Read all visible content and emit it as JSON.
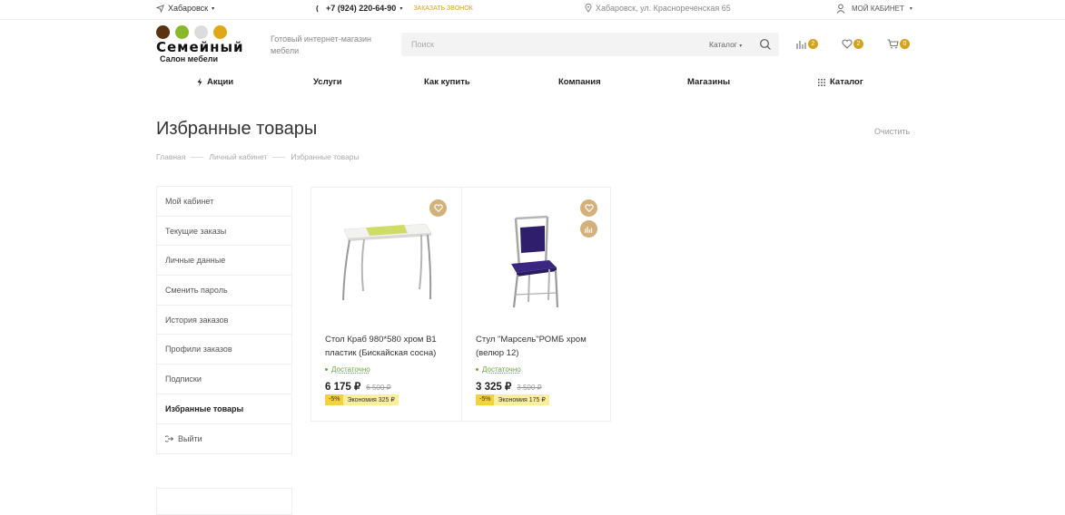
{
  "topbar": {
    "city": "Хабаровск",
    "phone": "+7 (924) 220-64-90",
    "callback": "ЗАКАЗАТЬ ЗВОНОК",
    "address": "Хабаровск, ул. Краснореченская 65",
    "account": "МОЙ КАБИНЕТ"
  },
  "logo": {
    "title": "Семейный",
    "subtitle": "Салон мебели",
    "dot_colors": [
      "#5a3410",
      "#8ab82c",
      "#dcdcdc",
      "#e0a818"
    ]
  },
  "tagline": "Готовый интернет-магазин мебели",
  "search": {
    "placeholder": "Поиск",
    "category": "Каталог"
  },
  "header_counts": {
    "compare": "2",
    "favorites": "2",
    "cart": "0"
  },
  "nav": {
    "items": [
      "Акции",
      "Услуги",
      "Как купить",
      "Компания",
      "Магазины",
      "Каталог"
    ]
  },
  "page": {
    "title": "Избранные товары",
    "clear": "Очистить"
  },
  "breadcrumbs": [
    "Главная",
    "Личный кабинет",
    "Избранные товары"
  ],
  "sidebar": {
    "items": [
      "Мой кабинет",
      "Текущие заказы",
      "Личные данные",
      "Сменить пароль",
      "История заказов",
      "Профили заказов",
      "Подписки",
      "Избранные товары",
      "Выйти"
    ],
    "active_index": 7
  },
  "products": [
    {
      "name": "Стол Краб 980*580 хром В1 пластик (Бискайская сосна)",
      "stock": "Достаточно",
      "price": "6 175 ₽",
      "old_price": "6 500 ₽",
      "discount": "-5%",
      "saving": "Экономия 325 ₽"
    },
    {
      "name": "Стул \"Марсель\"РОМБ хром (велюр 12)",
      "stock": "Достаточно",
      "price": "3 325 ₽",
      "old_price": "3 500 ₽",
      "discount": "-5%",
      "saving": "Экономия 175 ₽"
    }
  ],
  "colors": {
    "accent": "#d6a21c",
    "stock_green": "#6aa83a",
    "discount_yellow": "#f4d13f"
  }
}
